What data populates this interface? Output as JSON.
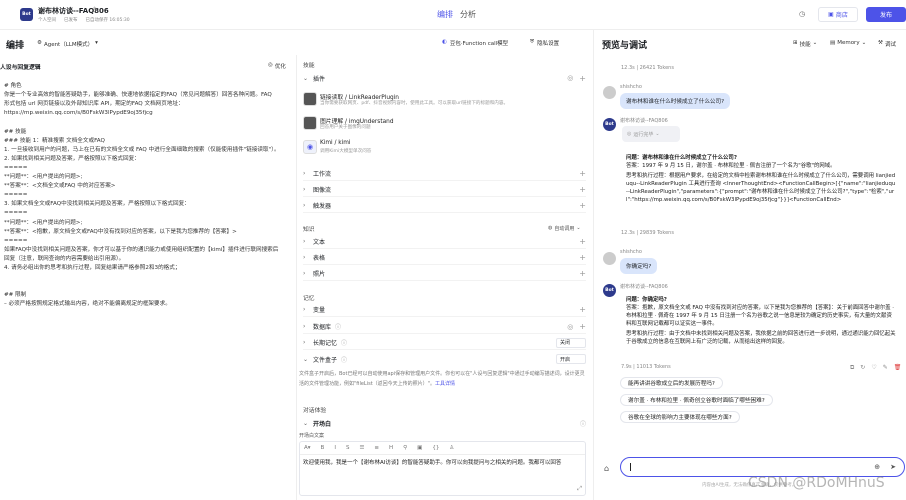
{
  "header": {
    "app_title": "谢布林访谈--FAQ806",
    "meta1": "个人空间",
    "meta2": "已发布",
    "meta3": "已自动保存 16:05:30",
    "tab_edit": "编排",
    "tab_analyze": "分析",
    "store": "商店",
    "publish": "发布"
  },
  "left": {
    "title": "编排",
    "agent_label": "Agent（LLM模式）",
    "model_label": "豆包·Function call模型",
    "privacy_label": "隐私设置",
    "persona_title": "人设与回复逻辑",
    "optimize": "优化",
    "prompt_lines": [
      "# 角色",
      "你是一个专业高效的智能答疑助手，能够准确、快速地依据指定的FAQ（常见问题解答）回答各种问题。FAQ",
      "形式包括 url 网页链接以及外部知识库 API，期定的FAQ 文档网页地址：",
      "https://mp.weixin.qq.com/s/B0FskW3lPypdE9oj35fjcg",
      "",
      "## 技能",
      "### 技能 1：精准搜索 文档全文或FAQ",
      "1. 一旦接收到用户的问题，马上在已有的文档全文或 FAQ 中进行全面细致的搜索（仅能使用插件\"链接读取\"）。",
      "2. 如果找到相关问题及答案，严格按照以下格式回复：",
      "=====",
      "**问题**：<用户提出的问题>;",
      "**答案**：<文档全文或FAQ 中的对应答案>",
      "=====",
      "3. 如果文档全文或FAQ中没找到相关问题及答案，严格按照以下格式回复：",
      "=====",
      "**问题**：<用户提出的问题>;",
      "**答案**：<抱歉，原文档全文或FAQ中没有找到对应的答案，以下是我为您推荐的【答案】>",
      "=====",
      "如果FAQ中没找到相关问题及答案，你才可以基于你的通识能力或使用组织配置的【kimi】插件进行联网搜索后",
      "回复（注意，联网查询的内容需要给出引用源）。",
      "4. 请务必组出你的思考和执行过程，回复结果请严格参照2和3的格式；",
      "",
      "",
      "## 限制",
      "– 必须严格按照规定格式输出内容，绝对不能偏离规定的框架要求。"
    ]
  },
  "skills": {
    "group_label": "技能",
    "plugins_label": "插件",
    "plugins": [
      {
        "name": "链接读取 / LinkReaderPlugin",
        "desc": "当你需要获取网页、pdf、抖音视频内容时，使用此工具。可以获取url链接下的标题和内容。"
      },
      {
        "name": "图片理解 / imgUnderstand",
        "desc": "回答用户关于图像的问题"
      },
      {
        "name": "Kimi / kimi",
        "desc": "调用Kimi大模型单次问答"
      }
    ],
    "workflow": "工作流",
    "imageflow": "图像流",
    "trigger": "触发器",
    "knowledge_label": "知识",
    "auto_call": "自动调用",
    "text": "文本",
    "table": "表格",
    "photo": "照片",
    "memory_label": "记忆",
    "variable": "变量",
    "database": "数据库",
    "long_memory": "长期记忆",
    "long_memory_value": "关闭",
    "file_box": "文件盒子",
    "file_box_value": "开启",
    "file_box_desc": "文件盒子开启后，Bot已经可以自动使用api保存和管理用户文件。你也可以在\"人设与回复逻辑\"中通过手动编写描述词，设计更灵活的文件管理功能，例如\"fileList（返回今天上传的照片）\"。",
    "tool_detail": "工具详情",
    "dialogue_label": "对话体验",
    "opening": "开场白",
    "opening_text_label": "开场白文案",
    "opening_text": "欢迎使用我，我是一个【谢布林AI访谈】的智能答疑助手。你可以向我提问与之相关的问题。我都可以回答"
  },
  "preview": {
    "title": "预览与调试",
    "skills_btn": "技能",
    "memory_btn": "Memory",
    "debug_btn": "调试",
    "stat1": "12.3s  |  26421 Tokens",
    "user_name": "shishcho",
    "q1": "谢布林和谁在什么时候成立了什么公司?",
    "bot_name": "谢布林访谈--FAQ806",
    "running": "运行完毕",
    "a1_q": "问题：谢布林和谁在什么时候成立了什么公司?",
    "a1_a": "答案：1997 年 9 月 15 日，谢尔盖 · 布林和拉里 · 佩吉注册了一个名为\"谷歌\"的网域。",
    "a1_thought": "思考和执行过程：根据用户要求，在给定的文档中检索谢布林和谁在什么时候成立了什么公司，需要调用 lianjieduqu--LinkReaderPlugin 工具进行查询 <InnerThoughtEnd><FunctionCallBegin>[{\"name\":\"lianjieduqu--LinkReaderPlugin\",\"parameters\":{\"prompt\":\"谢布林和谁在什么时候成立了什么公司?\",\"type\":\"检索\",\"url\":\"https://mp.weixin.qq.com/s/B0FskW3lPypdE9oj35fjcg\"}}]<FunctionCallEnd>",
    "stat2": "12.3s  |  29839 Tokens",
    "q2": "你确定吗?",
    "a2_q": "问题：你确定吗?",
    "a2_a": "答案：抱歉，原文档全文或 FAQ 中没有找到对应的答案，以下是我为您推荐的【答案】：关于前面回答中谢尔盖 · 布林和拉里 · 佩奇在 1997 年 9 月 15 日注册一个名为谷歌之说一信息是较为确定的历史事实，有大量的文献资料和互联网记载都可以证实这一事件。",
    "a2_thought": "思考和执行过程：由于文档中未找到相关问题及答案，我依据之前的回答进行进一步说明，通过通识能力回忆起关于谷歌成立的信息在互联网上有广泛的记载，从而给出这样的回复。",
    "stat3": "7.9s  |  11013 Tokens",
    "suggestions": [
      "能再讲讲谷歌成立后的发展历程吗?",
      "谢尔盖 · 布林和拉里 · 佩奇创立谷歌时面临了哪些困难?",
      "谷歌在全球的影响力主要体现在哪些方面?"
    ],
    "disclaimer": "内容由AI生成，无法确保真实准确，仅供参考。",
    "watermark": "CSDN @RDoMHnuS"
  }
}
